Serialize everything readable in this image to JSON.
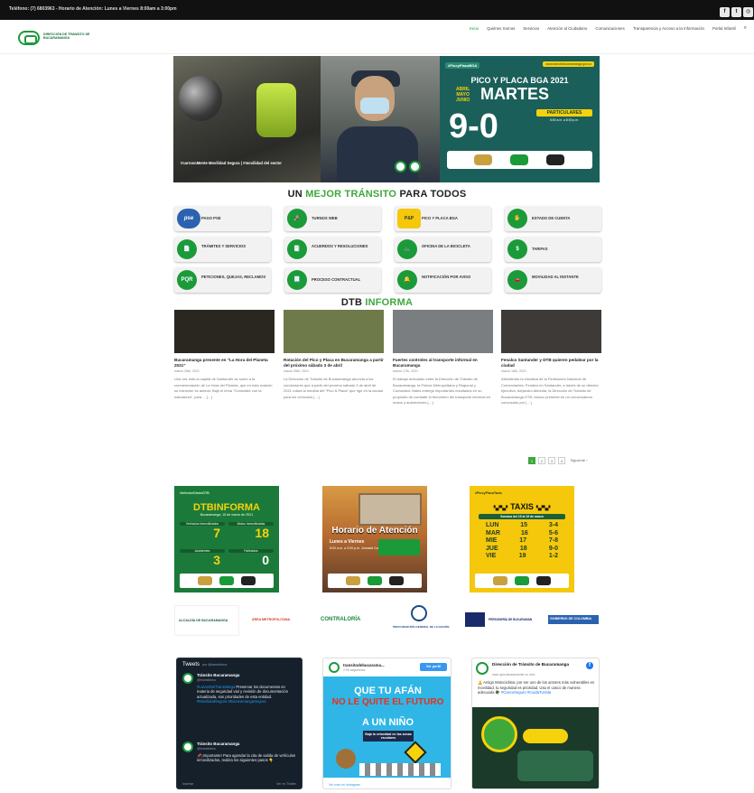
{
  "topbar": {
    "text": "Teléfono: (7) 6803963 - Horario de Atención: Lunes a Viernes 8:00am a 3:00pm",
    "social_icons": [
      "facebook-icon",
      "twitter-icon",
      "instagram-icon"
    ]
  },
  "header": {
    "logo_text": "DIRECCIÓN DE TRÁNSITO DE BUCARAMANGA",
    "nav": [
      "Inicio",
      "Quiénes Somos",
      "Servicios",
      "Atención al Ciudadano",
      "Comunicaciones",
      "Transparencia y Acceso a la Información",
      "Portal Infantil"
    ],
    "active_nav": "Inicio"
  },
  "hero": {
    "caption": "#carrosoMente Movilidad Segura  |  #movilidad del sector",
    "pyp": {
      "tag": "#PicoyPlacaBGA",
      "site": "www.transitobucaramanga.gov.co",
      "title": "PICO Y PLACA BGA 2021",
      "months": [
        "ABRIL",
        "MAYO",
        "JUNIO"
      ],
      "day": "MARTES",
      "numbers": "9-0",
      "particulares": "PARTICULARES",
      "hours": "6:00 a.m. a 8:00 p.m."
    }
  },
  "section1": {
    "pre": "UN ",
    "highlight": "MEJOR TRÁNSITO",
    "post": " PARA TODOS"
  },
  "services": [
    {
      "icon": "pse-icon",
      "glyph": "pse",
      "label": "PAGO PSE"
    },
    {
      "icon": "rocket-icon",
      "glyph": "🚀",
      "label": "TURNOS WEB"
    },
    {
      "icon": "pico-placa-icon",
      "glyph": "P&P",
      "label": "PICO Y PLACA BGA"
    },
    {
      "icon": "hand-coin-icon",
      "glyph": "✋",
      "label": "ESTADO DE CUENTA"
    },
    {
      "icon": "document-icon",
      "glyph": "📄",
      "label": "TRÁMITES Y SERVICIOS"
    },
    {
      "icon": "agreements-icon",
      "glyph": "📑",
      "label": "ACUERDOS Y RESOLUCIONES"
    },
    {
      "icon": "bicycle-icon",
      "glyph": "🚲",
      "label": "OFICINA DE LA BICICLETA"
    },
    {
      "icon": "dollar-icon",
      "glyph": "$",
      "label": "TARIFAS"
    },
    {
      "icon": "pqr-icon",
      "glyph": "PQR",
      "label": "PETICIONES, QUEJAS, RECLAMOS"
    },
    {
      "icon": "contract-icon",
      "glyph": "📃",
      "label": "PROCESO CONTRACTUAL"
    },
    {
      "icon": "bell-icon",
      "glyph": "🔔",
      "label": "NOTIFICACIÓN POR AVISO"
    },
    {
      "icon": "car-icon",
      "glyph": "🚗",
      "label": "MOVILIDAD AL INSTANTE"
    }
  ],
  "section2": {
    "pre": "DTB ",
    "highlight": "INFORMA"
  },
  "news": [
    {
      "title": "Bucaramanga presente en “La Hora del Planeta 2021”",
      "date": "marzo 26th, 2021",
      "excerpt": "Una vez más la capital de Santander se sumó a la conmemoración de La Hora del Planeta, que en esta ocasión su intención es animar. Bajo el lema “Conéctate con la naturaleza”, para ... […]",
      "img_color": "#2a2620"
    },
    {
      "title": "Rotación del Pico y Placa en Bucaramanga a partir del próximo sábado 3 de abril",
      "date": "marzo 26th, 2021",
      "excerpt": "La Dirección de Tránsito de Bucaramanga anuncia a los conductores que a partir del próximo sábado 3 de abril de 2021 rotará la medida del “Pico & Placa” que rige en la ciudad para los vehículos […]",
      "img_color": "#6f7a4a"
    },
    {
      "title": "Fuertes controles al transporte informal en Bucaramanga",
      "date": "marzo 17th, 2021",
      "excerpt": "El trabajo articulado entre la Dirección de Tránsito de Bucaramanga, la Policía Metropolitana y Regional y Comandos Viales entregó importantes resultados en su propósito de combatir el fenómeno del transporte informal en motos y automotores […]",
      "img_color": "#7a7e80"
    },
    {
      "title": "Fenalco Santander y DTB quieren pedalear por la ciudad",
      "date": "marzo 16th, 2021",
      "excerpt": "Atendiendo la iniciativa de la Federación Nacional de Comerciantes, Fenalco en Santander, a través de su director ejecutivo, Alejandro Almeida, la Dirección de Tránsito de Bucaramanga DTB, estuvo presente en un conversatorio convocado por […]",
      "img_color": "#3e3a38"
    }
  ],
  "pagination": {
    "pages": [
      "1",
      "2",
      "3",
      "4"
    ],
    "current": "1",
    "next": "Siguiente ›"
  },
  "posters": {
    "dtb_informa": {
      "tag": "#InformeDiarioDTB",
      "title": "DTBINFORMA",
      "date": "Bucaramanga, 15 de marzo de 2021",
      "stats": [
        {
          "label": "Vehículos Inmovilizados",
          "value": "7"
        },
        {
          "label": "Motos Inmovilizadas",
          "value": "18"
        },
        {
          "label": "Accidentes",
          "value": "3"
        },
        {
          "label": "Fallecidos",
          "value": "0"
        }
      ]
    },
    "horario": {
      "title": "Horario de Atención",
      "days": "Lunes a Viernes",
      "hours": "8:00 a.m. a 3:00 p.m. Jornada Continua"
    },
    "taxis": {
      "tag": "#PicoyPlacaTaxis",
      "title": "TAXIS",
      "subtitle": "Semana del 15 al 19 de marzo",
      "rows": [
        {
          "day": "LUN",
          "date": "15",
          "plates": "3-4"
        },
        {
          "day": "MAR",
          "date": "16",
          "plates": "5-6"
        },
        {
          "day": "MIE",
          "date": "17",
          "plates": "7-8"
        },
        {
          "day": "JUE",
          "date": "18",
          "plates": "9-0"
        },
        {
          "day": "VIE",
          "date": "19",
          "plates": "1-2"
        }
      ]
    }
  },
  "partner_logos": [
    "ALCALDÍA DE BUCARAMANGA",
    "ÁREA METROPOLITANA",
    "CONTRALORÍA",
    "PROCURADURÍA GENERAL DE LA NACIÓN",
    "PERSONERÍA DE BUCARAMANGA",
    "GOBIERNO DE COLOMBIA"
  ],
  "twitter": {
    "heading": "Tweets",
    "by": "por @transitobuc",
    "tweets": [
      {
        "name": "Tránsito Bucaramanga",
        "handle": "@transitobuc",
        "link": "#LaVozDelTransitobga",
        "text": "Preservar los documentos en materia de seguridad vial y revisión de documentación actualizada, son prioridades de esta entidad.",
        "tags": "#MovilidadSegura #BucaramangaSegura"
      },
      {
        "name": "Tránsito Bucaramanga",
        "handle": "@transitobuc",
        "text": "📌¡Importante! Para agendar la cita de salida de vehículos inmovilizados, realiza los siguientes pasos 👇"
      }
    ],
    "embed": "Insertar",
    "view": "Ver en Twitter"
  },
  "instagram": {
    "account": "transitodebucarama...",
    "followers": "2.9K seguidores",
    "button": "Ver perfil",
    "line1": "QUE TU AFÁN",
    "line2": "NO LE QUITE EL FUTURO",
    "line3": "A UN NIÑO",
    "sub": "Baja la velocidad en las zonas escolares",
    "link": "Ver más en Instagram"
  },
  "facebook": {
    "page": "Dirección de Tránsito de Bucaramanga",
    "time": "hace aproximadamente un mes",
    "text": "🔔 Amigo Motociclista: por ser uno de los actores más vulnerables en movilidad, tu seguridad es prioridad. Usa el casco de manera adecuada 🪖",
    "tags": "#CascoSeguro #CuidaTuVida"
  }
}
